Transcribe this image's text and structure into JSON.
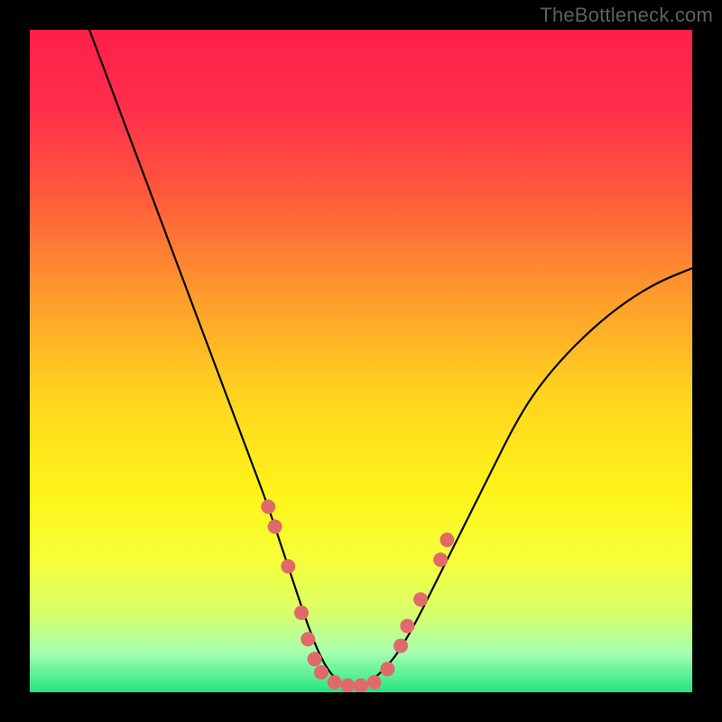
{
  "watermark": "TheBottleneck.com",
  "colors": {
    "gradient_stops": [
      {
        "offset": 0.0,
        "color": "#ff1f4a"
      },
      {
        "offset": 0.12,
        "color": "#ff2f4a"
      },
      {
        "offset": 0.25,
        "color": "#ff5a3c"
      },
      {
        "offset": 0.4,
        "color": "#ff9a2c"
      },
      {
        "offset": 0.55,
        "color": "#ffd41f"
      },
      {
        "offset": 0.7,
        "color": "#fff41a"
      },
      {
        "offset": 0.8,
        "color": "#f6ff3a"
      },
      {
        "offset": 0.88,
        "color": "#d8ff6a"
      },
      {
        "offset": 0.94,
        "color": "#a6ffb0"
      },
      {
        "offset": 1.0,
        "color": "#24e57e"
      }
    ],
    "curve": "#000000",
    "marker_fill": "#e06a6a",
    "marker_stroke": "#c84d4d",
    "frame": "#000000"
  },
  "chart_data": {
    "type": "line",
    "title": "",
    "xlabel": "",
    "ylabel": "",
    "xlim": [
      0,
      100
    ],
    "ylim": [
      0,
      100
    ],
    "grid": false,
    "legend": false,
    "series": [
      {
        "name": "curve",
        "x": [
          9,
          12,
          15,
          18,
          21,
          24,
          27,
          30,
          33,
          36,
          38,
          40,
          42,
          44,
          46,
          48,
          50,
          52,
          55,
          58,
          61,
          64,
          67,
          70,
          73,
          76,
          80,
          85,
          90,
          95,
          100
        ],
        "y": [
          100,
          92,
          84,
          76,
          68,
          60,
          52,
          44,
          36,
          28,
          22,
          16,
          10,
          5,
          2,
          1,
          1,
          2,
          5,
          10,
          16,
          22,
          28,
          34,
          40,
          45,
          50,
          55,
          59,
          62,
          64
        ]
      }
    ],
    "markers": [
      {
        "x": 36,
        "y": 28
      },
      {
        "x": 37,
        "y": 25
      },
      {
        "x": 39,
        "y": 19
      },
      {
        "x": 41,
        "y": 12
      },
      {
        "x": 42,
        "y": 8
      },
      {
        "x": 43,
        "y": 5
      },
      {
        "x": 44,
        "y": 3
      },
      {
        "x": 46,
        "y": 1.5
      },
      {
        "x": 48,
        "y": 1
      },
      {
        "x": 50,
        "y": 1
      },
      {
        "x": 52,
        "y": 1.5
      },
      {
        "x": 54,
        "y": 3.5
      },
      {
        "x": 56,
        "y": 7
      },
      {
        "x": 57,
        "y": 10
      },
      {
        "x": 59,
        "y": 14
      },
      {
        "x": 62,
        "y": 20
      },
      {
        "x": 63,
        "y": 23
      }
    ],
    "marker_radius_px": 8
  }
}
